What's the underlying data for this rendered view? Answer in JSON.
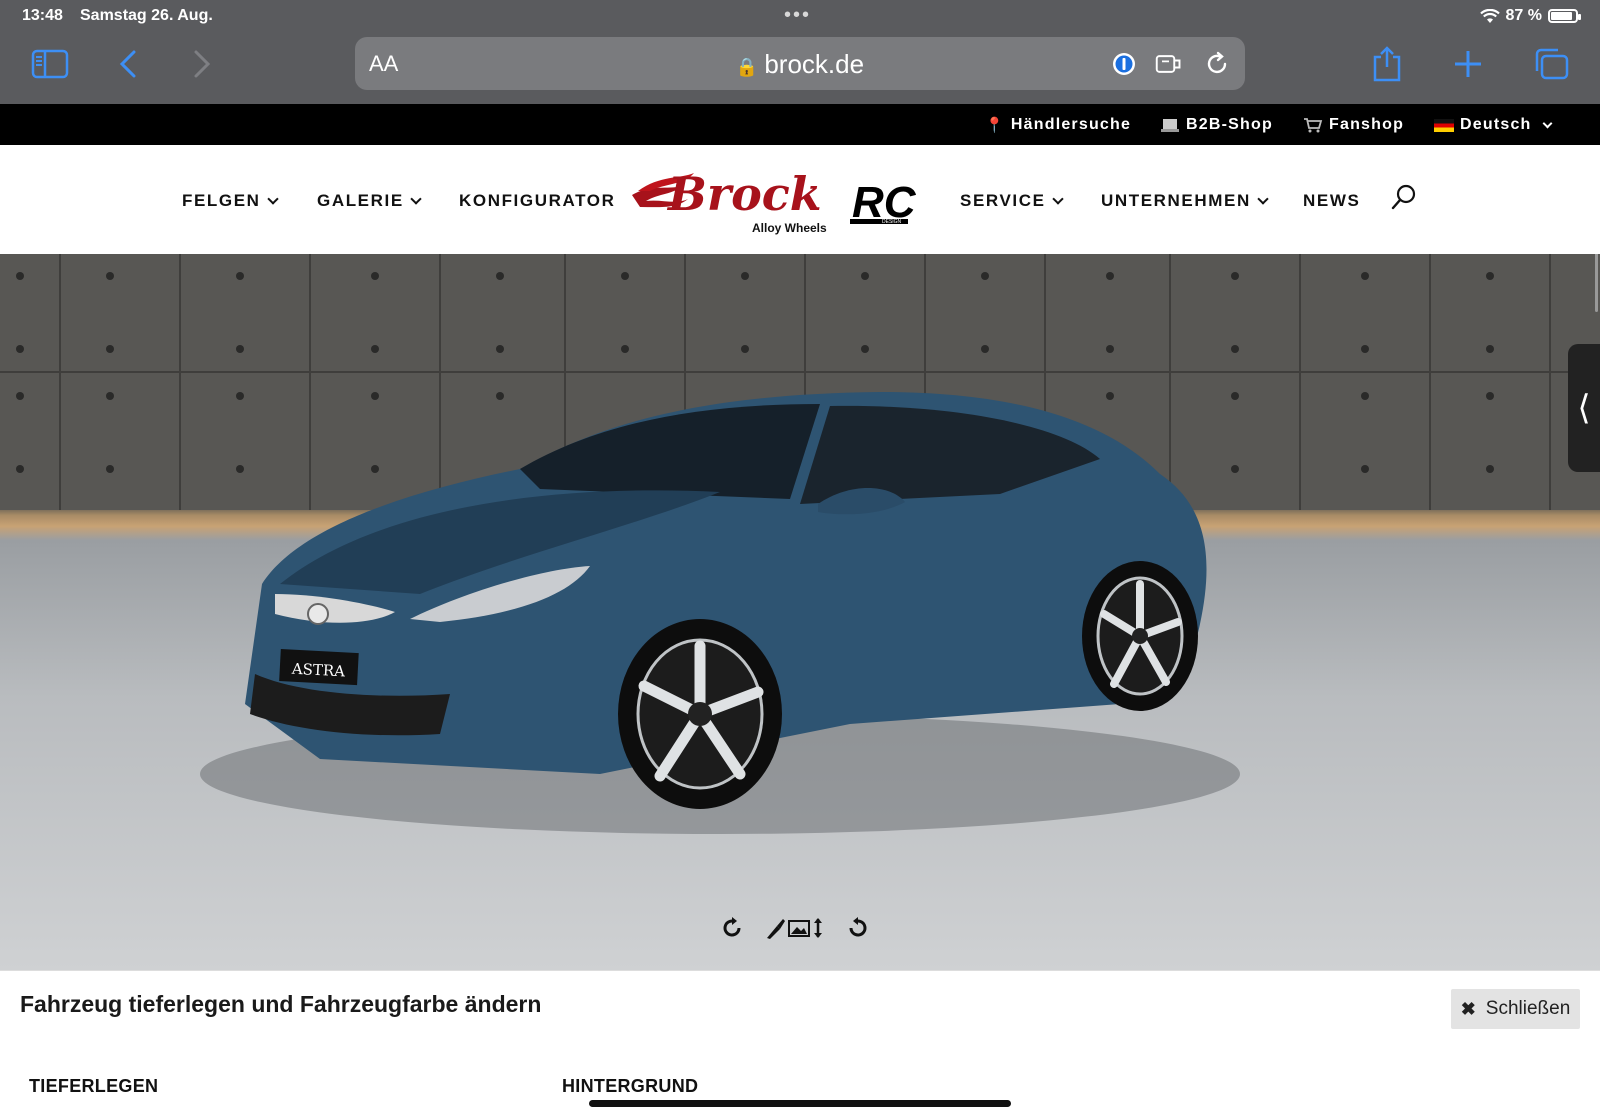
{
  "status": {
    "time": "13:48",
    "date": "Samstag 26. Aug.",
    "battery": "87 %",
    "battery_level": 0.87
  },
  "browser": {
    "text_size_label": "AA",
    "url": "brock.de"
  },
  "topbar": {
    "dealer_search": "Händlersuche",
    "b2b_shop": "B2B-Shop",
    "fanshop": "Fanshop",
    "language": "Deutsch"
  },
  "nav": {
    "felgen": "FELGEN",
    "galerie": "GALERIE",
    "konfigurator": "KONFIGURATOR",
    "service": "SERVICE",
    "unternehmen": "UNTERNEHMEN",
    "news": "NEWS"
  },
  "logo": {
    "brand": "Brock",
    "tagline": "Alloy Wheels",
    "rc": "RC",
    "rc_sub": "DESIGN"
  },
  "hero": {
    "car_plate": "ASTRA",
    "car_color": "#2e5472"
  },
  "panel": {
    "title": "Fahrzeug tieferlegen und Fahrzeugfarbe ändern",
    "close_label": "Schließen",
    "section_lower": "TIEFERLEGEN",
    "section_background": "HINTERGRUND"
  },
  "colors": {
    "safari_blue": "#3d8ff5",
    "brand_red": "#c0141c"
  }
}
